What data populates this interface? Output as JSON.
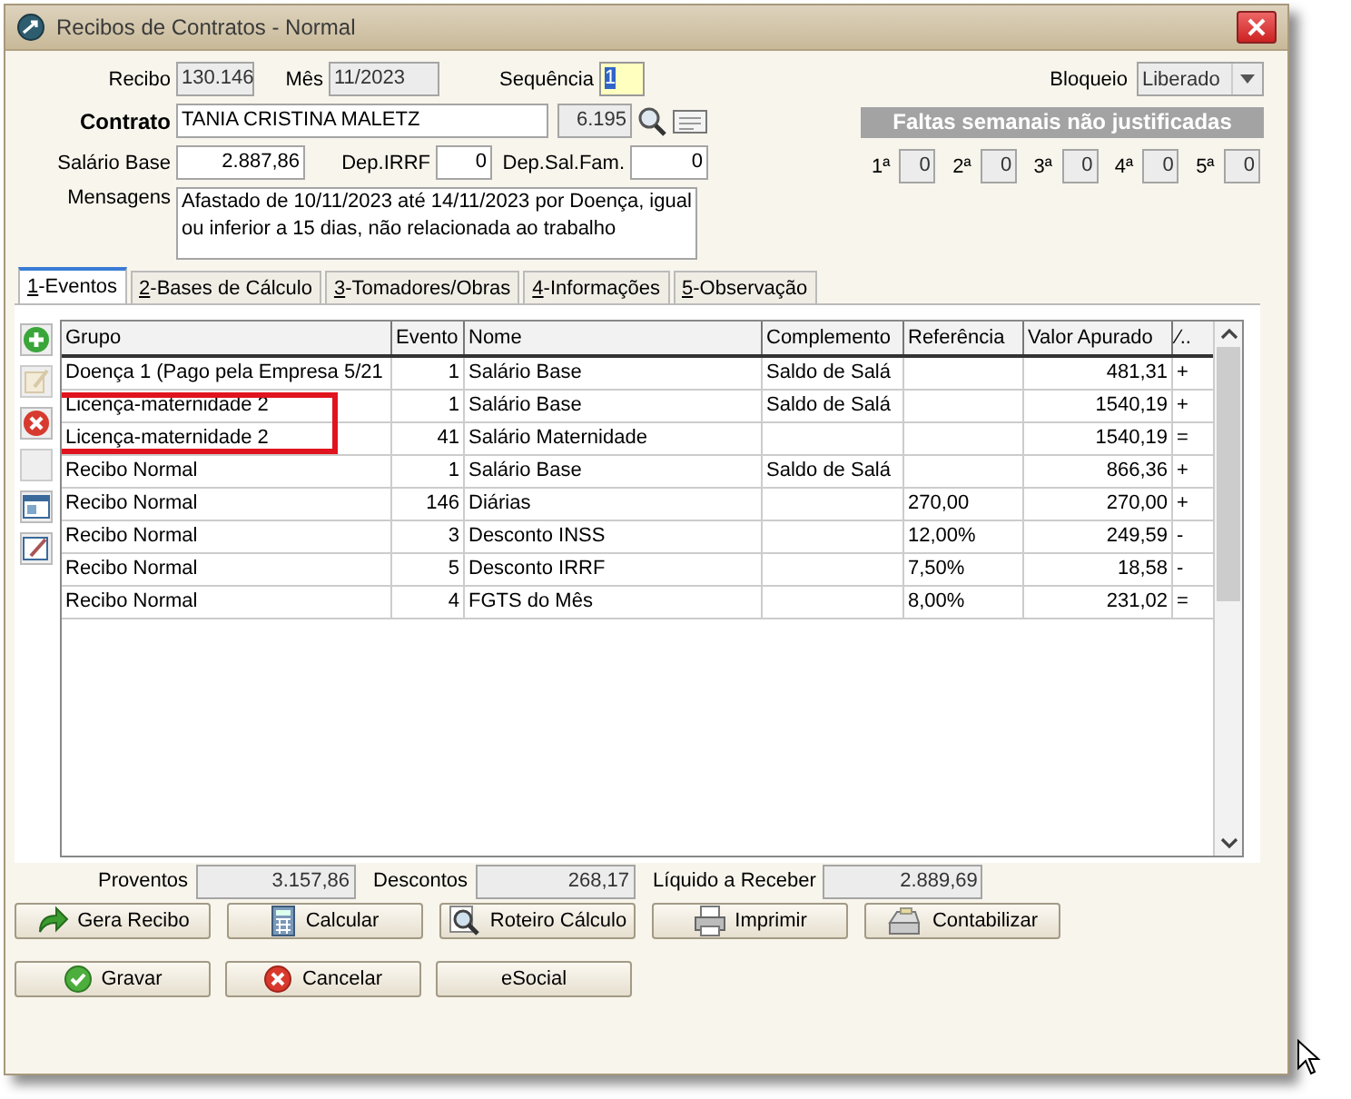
{
  "window": {
    "title": "Recibos de Contratos - Normal"
  },
  "form": {
    "recibo_label": "Recibo",
    "recibo": "130.146",
    "mes_label": "Mês",
    "mes": "11/2023",
    "sequencia_label": "Sequência",
    "sequencia": "1",
    "bloqueio_label": "Bloqueio",
    "bloqueio": "Liberado",
    "contrato_label": "Contrato",
    "contrato": "TANIA CRISTINA MALETZ",
    "contrato_codigo": "6.195",
    "salario_label": "Salário Base",
    "salario": "2.887,86",
    "dep_irrf_label": "Dep.IRRF",
    "dep_irrf": "0",
    "dep_sal_fam_label": "Dep.Sal.Fam.",
    "dep_sal_fam": "0",
    "mensagens_label": "Mensagens",
    "mensagens": "Afastado de 10/11/2023 até 14/11/2023 por Doença, igual ou inferior a 15 dias, não relacionada ao trabalho"
  },
  "faltas": {
    "title": "Faltas semanais não justificadas",
    "weeks": [
      {
        "label": "1ª",
        "value": "0"
      },
      {
        "label": "2ª",
        "value": "0"
      },
      {
        "label": "3ª",
        "value": "0"
      },
      {
        "label": "4ª",
        "value": "0"
      },
      {
        "label": "5ª",
        "value": "0"
      }
    ]
  },
  "tabs": [
    {
      "key": "1",
      "label": "-Eventos",
      "selected": true
    },
    {
      "key": "2",
      "label": "-Bases de Cálculo",
      "selected": false
    },
    {
      "key": "3",
      "label": "-Tomadores/Obras",
      "selected": false
    },
    {
      "key": "4",
      "label": "-Informações",
      "selected": false
    },
    {
      "key": "5",
      "label": "-Observação",
      "selected": false
    }
  ],
  "table": {
    "columns": [
      "Grupo",
      "Evento",
      "Nome",
      "Complemento",
      "Referência",
      "Valor Apurado",
      "⁄.."
    ],
    "rows": [
      {
        "cells": [
          "Doença 1 (Pago pela Empresa 5/21",
          "1",
          "Salário Base",
          "Saldo de Salá",
          "",
          "481,31",
          "+"
        ],
        "highlighted": false
      },
      {
        "cells": [
          "Licença-maternidade 2",
          "1",
          "Salário Base",
          "Saldo de Salá",
          "",
          "1540,19",
          "+"
        ],
        "highlighted": true
      },
      {
        "cells": [
          "Licença-maternidade 2",
          "41",
          "Salário Maternidade",
          "",
          "",
          "1540,19",
          "="
        ],
        "highlighted": true
      },
      {
        "cells": [
          "Recibo Normal",
          "1",
          "Salário Base",
          "Saldo de Salá",
          "",
          "866,36",
          "+"
        ],
        "highlighted": false
      },
      {
        "cells": [
          "Recibo Normal",
          "146",
          "Diárias",
          "",
          "270,00",
          "270,00",
          "+"
        ],
        "highlighted": false
      },
      {
        "cells": [
          "Recibo Normal",
          "3",
          "Desconto INSS",
          "",
          "12,00%",
          "249,59",
          "-"
        ],
        "highlighted": false
      },
      {
        "cells": [
          "Recibo Normal",
          "5",
          "Desconto IRRF",
          "",
          "7,50%",
          "18,58",
          "-"
        ],
        "highlighted": false
      },
      {
        "cells": [
          "Recibo Normal",
          "4",
          "FGTS do Mês",
          "",
          "8,00%",
          "231,02",
          "="
        ],
        "highlighted": false
      }
    ]
  },
  "totals": [
    {
      "label": "Proventos",
      "value": "3.157,86"
    },
    {
      "label": "Descontos",
      "value": "268,17"
    },
    {
      "label": "Líquido a Receber",
      "value": "2.889,69"
    }
  ],
  "actions": [
    {
      "label": "Gera Recibo"
    },
    {
      "label": "Calcular"
    },
    {
      "label": "Roteiro Cálculo"
    },
    {
      "label": "Imprimir"
    },
    {
      "label": "Contabilizar"
    }
  ],
  "buttons": [
    {
      "label": "Gravar"
    },
    {
      "label": "Cancelar"
    },
    {
      "label": "eSocial"
    }
  ]
}
